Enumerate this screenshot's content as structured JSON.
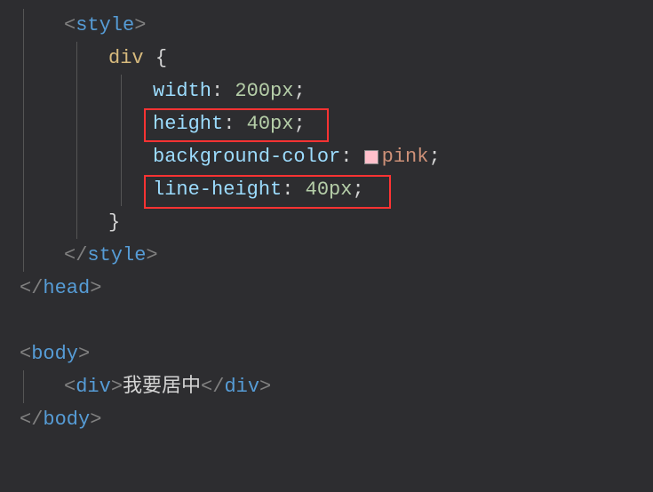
{
  "code": {
    "line1": {
      "tag": "style"
    },
    "line2": {
      "selector": "div",
      "brace": "{"
    },
    "line3": {
      "prop": "width",
      "value": "200px"
    },
    "line4": {
      "prop": "height",
      "value": "40px"
    },
    "line5": {
      "prop": "background-color",
      "value": "pink"
    },
    "line6": {
      "prop": "line-height",
      "value": "40px"
    },
    "line7": {
      "brace": "}"
    },
    "line8": {
      "closeTag": "style"
    },
    "line9": {
      "closeTag": "head"
    },
    "line11": {
      "tag": "body"
    },
    "line12": {
      "tag": "div",
      "text": "我要居中",
      "closeTag": "div"
    },
    "line13": {
      "closeTag": "body"
    }
  },
  "symbols": {
    "lt": "<",
    "gt": ">",
    "ltSlash": "</",
    "colon": ": ",
    "semi": ";"
  }
}
